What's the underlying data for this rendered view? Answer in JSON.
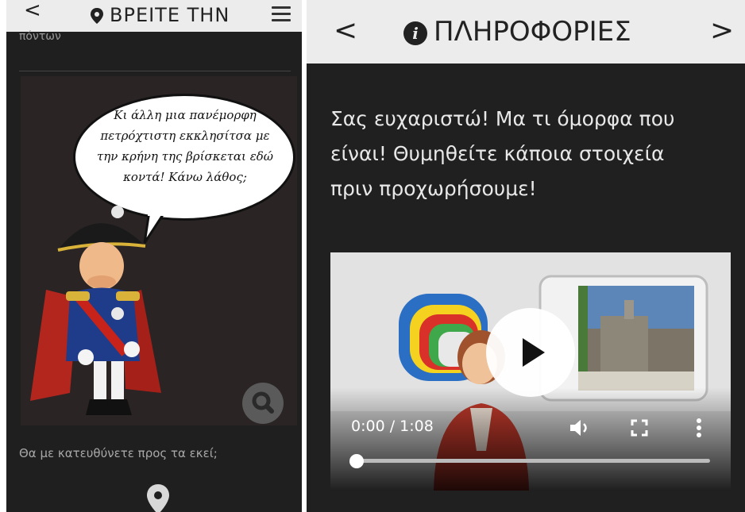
{
  "left": {
    "header": {
      "back": "<",
      "title": "ΒΡΕΙΤΕ ΤΗΝ"
    },
    "cut_text": "πόντων",
    "speech_bubble": [
      "Κι άλλη μια πανέμορφη",
      "πετρόχτιστη εκκλησίτσα με",
      "την κρήνη της βρίσκεται εδώ",
      "κοντά! Κάνω λάθος;"
    ],
    "question": "Θα με κατευθύνετε προς τα εκεί;"
  },
  "right": {
    "header": {
      "back": "<",
      "title": "ΠΛΗΡΟΦΟΡΙΕΣ",
      "next": ">"
    },
    "message": [
      "Σας ευχαριστώ! Μα τι όμορφα που",
      "είναι! Θυμηθείτε κάποια στοιχεία",
      "πριν προχωρήσουμε!"
    ],
    "video": {
      "time": "0:00 / 1:08",
      "progress": 0.0
    }
  },
  "icons": [
    "chevron-left-icon",
    "location-pin-icon",
    "hamburger-menu-icon",
    "search-icon",
    "info-icon",
    "chevron-right-icon",
    "play-icon",
    "volume-icon",
    "fullscreen-icon",
    "more-vert-icon"
  ]
}
